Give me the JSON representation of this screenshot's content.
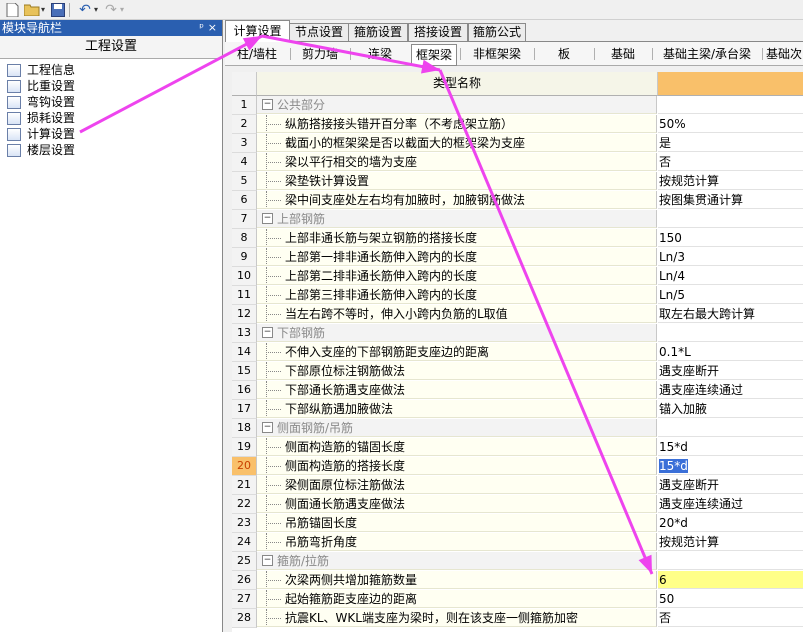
{
  "toolbar": {
    "icons": [
      "new-file-icon",
      "open-folder-icon",
      "save-icon",
      "undo-icon",
      "redo-icon"
    ]
  },
  "nav": {
    "title": "模块导航栏",
    "pin": "ᵖ",
    "close": "×",
    "section": "工程设置",
    "items": [
      {
        "label": "工程信息",
        "icon": "project-info-icon"
      },
      {
        "label": "比重设置",
        "icon": "gravity-icon"
      },
      {
        "label": "弯钩设置",
        "icon": "hook-icon"
      },
      {
        "label": "损耗设置",
        "icon": "loss-icon"
      },
      {
        "label": "计算设置",
        "icon": "calc-settings-icon"
      },
      {
        "label": "楼层设置",
        "icon": "floor-icon"
      }
    ]
  },
  "tabs": [
    {
      "label": "计算设置",
      "active": true
    },
    {
      "label": "节点设置",
      "active": false
    },
    {
      "label": "箍筋设置",
      "active": false
    },
    {
      "label": "搭接设置",
      "active": false
    },
    {
      "label": "箍筋公式",
      "active": false
    }
  ],
  "subtabs": [
    {
      "label": "柱/墙柱",
      "active": false
    },
    {
      "label": "剪力墙",
      "active": false
    },
    {
      "label": "连梁",
      "active": false
    },
    {
      "label": "框架梁",
      "active": true
    },
    {
      "label": "非框架梁",
      "active": false
    },
    {
      "label": "板",
      "active": false
    },
    {
      "label": "基础",
      "active": false
    },
    {
      "label": "基础主梁/承台梁",
      "active": false
    },
    {
      "label": "基础次",
      "active": false
    }
  ],
  "grid": {
    "header": "类型名称",
    "rows": [
      {
        "n": "1",
        "type": "group",
        "name": "公共部分",
        "value": ""
      },
      {
        "n": "2",
        "type": "item",
        "name": "纵筋搭接接头错开百分率（不考虑架立筋）",
        "value": "50%"
      },
      {
        "n": "3",
        "type": "item",
        "name": "截面小的框架梁是否以截面大的框架梁为支座",
        "value": "是"
      },
      {
        "n": "4",
        "type": "item",
        "name": "梁以平行相交的墙为支座",
        "value": "否"
      },
      {
        "n": "5",
        "type": "item",
        "name": "梁垫铁计算设置",
        "value": "按规范计算"
      },
      {
        "n": "6",
        "type": "item",
        "name": "梁中间支座处左右均有加腋时，加腋钢筋做法",
        "value": "按图集贯通计算"
      },
      {
        "n": "7",
        "type": "group",
        "name": "上部钢筋",
        "value": ""
      },
      {
        "n": "8",
        "type": "item",
        "name": "上部非通长筋与架立钢筋的搭接长度",
        "value": "150"
      },
      {
        "n": "9",
        "type": "item",
        "name": "上部第一排非通长筋伸入跨内的长度",
        "value": "Ln/3"
      },
      {
        "n": "10",
        "type": "item",
        "name": "上部第二排非通长筋伸入跨内的长度",
        "value": "Ln/4"
      },
      {
        "n": "11",
        "type": "item",
        "name": "上部第三排非通长筋伸入跨内的长度",
        "value": "Ln/5"
      },
      {
        "n": "12",
        "type": "item",
        "name": "当左右跨不等时，伸入小跨内负筋的L取值",
        "value": "取左右最大跨计算"
      },
      {
        "n": "13",
        "type": "group",
        "name": "下部钢筋",
        "value": ""
      },
      {
        "n": "14",
        "type": "item",
        "name": "不伸入支座的下部钢筋距支座边的距离",
        "value": "0.1*L"
      },
      {
        "n": "15",
        "type": "item",
        "name": "下部原位标注钢筋做法",
        "value": "遇支座断开"
      },
      {
        "n": "16",
        "type": "item",
        "name": "下部通长筋遇支座做法",
        "value": "遇支座连续通过"
      },
      {
        "n": "17",
        "type": "item",
        "name": "下部纵筋遇加腋做法",
        "value": "锚入加腋"
      },
      {
        "n": "18",
        "type": "group",
        "name": "侧面钢筋/吊筋",
        "value": ""
      },
      {
        "n": "19",
        "type": "item",
        "name": "侧面构造筋的锚固长度",
        "value": "15*d"
      },
      {
        "n": "20",
        "type": "item",
        "name": "侧面构造筋的搭接长度",
        "value": "15*d",
        "selected": true
      },
      {
        "n": "21",
        "type": "item",
        "name": "梁侧面原位标注筋做法",
        "value": "遇支座断开"
      },
      {
        "n": "22",
        "type": "item",
        "name": "侧面通长筋遇支座做法",
        "value": "遇支座连续通过"
      },
      {
        "n": "23",
        "type": "item",
        "name": "吊筋锚固长度",
        "value": "20*d"
      },
      {
        "n": "24",
        "type": "item",
        "name": "吊筋弯折角度",
        "value": "按规范计算"
      },
      {
        "n": "25",
        "type": "group",
        "name": "箍筋/拉筋",
        "value": ""
      },
      {
        "n": "26",
        "type": "item",
        "name": "次梁两侧共增加箍筋数量",
        "value": "6",
        "highlight": true
      },
      {
        "n": "27",
        "type": "item",
        "name": "起始箍筋距支座边的距离",
        "value": "50"
      },
      {
        "n": "28",
        "type": "item",
        "name": "抗震KL、WKL端支座为梁时，则在该支座一侧箍筋加密",
        "value": "否"
      }
    ]
  },
  "annotation": {
    "color": "#ee44ee"
  }
}
